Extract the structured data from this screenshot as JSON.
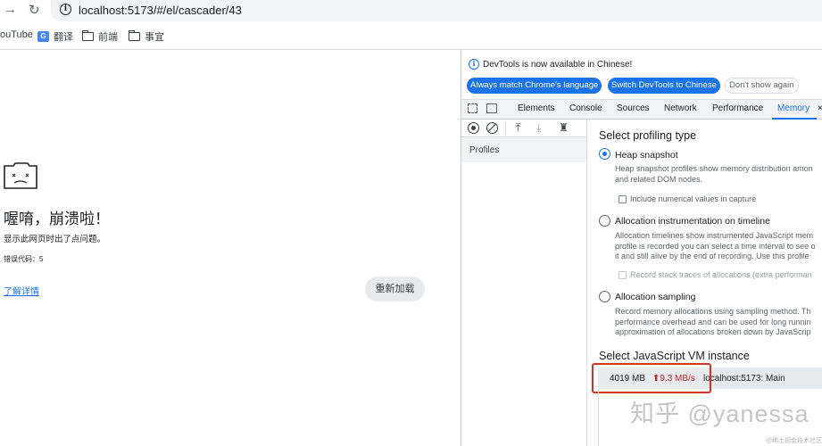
{
  "browser": {
    "back_icon": "arrow-left-icon",
    "reload_icon": "reload-icon",
    "url": "localhost:5173/#/el/cascader/43",
    "bookmarks": [
      {
        "label": "ouTube",
        "icon": "none"
      },
      {
        "label": "翻译",
        "icon": "google-translate-icon"
      },
      {
        "label": "前端",
        "icon": "folder-icon"
      },
      {
        "label": "事宜",
        "icon": "folder-icon"
      }
    ]
  },
  "crash_page": {
    "title": "喔唷，崩溃啦！",
    "description": "显示此网页时出了点问题。",
    "error_code": "错误代码：5",
    "learn_more": "了解详情",
    "reload": "重新加载"
  },
  "devtools": {
    "info_message": "DevTools is now available in Chinese!",
    "buttons": {
      "match_language": "Always match Chrome's language",
      "switch_chinese": "Switch DevTools to Chinese",
      "dont_show": "Don't show again"
    },
    "tabs": [
      "Elements",
      "Console",
      "Sources",
      "Network",
      "Performance",
      "Memory"
    ],
    "active_tab": "Memory",
    "sidebar": {
      "profiles_label": "Profiles"
    },
    "profiling": {
      "title": "Select profiling type",
      "options": [
        {
          "label": "Heap snapshot",
          "checked": true,
          "description": "Heap snapshot profiles show memory distribution amon\nand related DOM nodes.",
          "checkbox_label": "Include numerical values in capture",
          "checkbox_disabled": false
        },
        {
          "label": "Allocation instrumentation on timeline",
          "checked": false,
          "description": "Allocation timelines show instrumented JavaScript mem\nprofile is recorded you can select a time interval to see o\nit and still alive by the end of recording. Use this profile",
          "checkbox_label": "Record stack traces of allocations (extra performan",
          "checkbox_disabled": true
        },
        {
          "label": "Allocation sampling",
          "checked": false,
          "description": "Record memory allocations using sampling method. Th\nperformance overhead and can be used for long runnin\napproximation of allocations broken down by JavaScrip"
        }
      ]
    },
    "vm": {
      "title": "Select JavaScript VM instance",
      "memory": "4019 MB",
      "rate": "⬆9.3 MB/s",
      "target": "localhost:5173: Main"
    }
  },
  "watermark": {
    "text": "知乎 @yanessa",
    "small": "@稀土掘金技术社区"
  }
}
